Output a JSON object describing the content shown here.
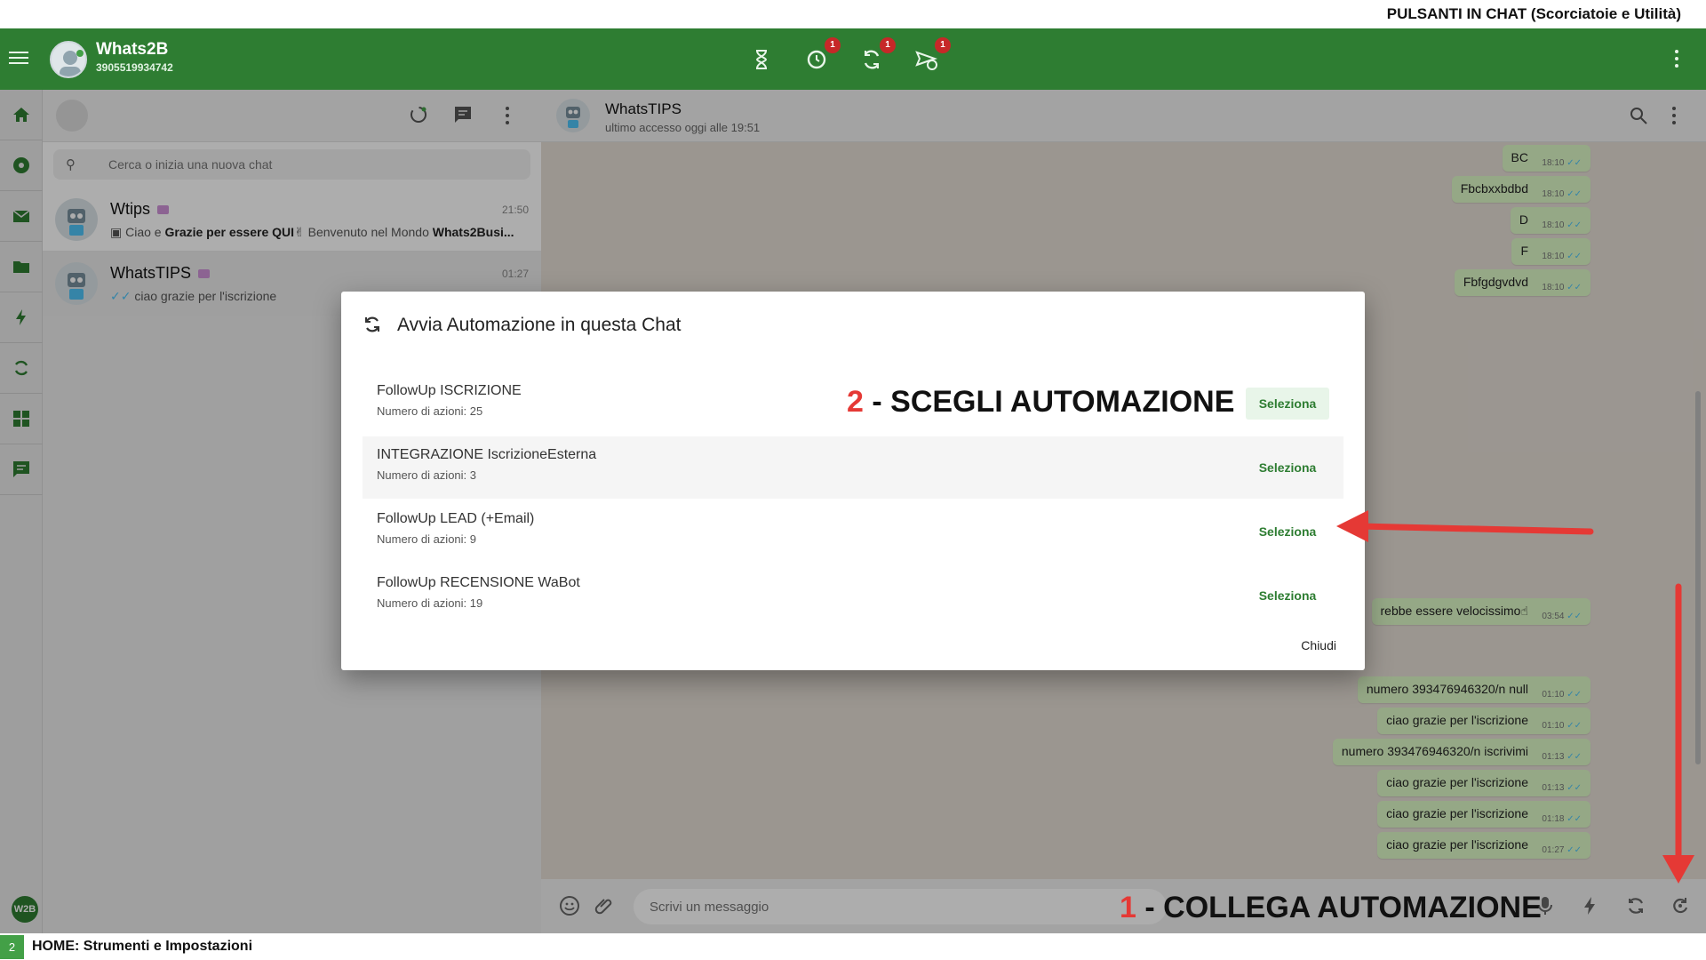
{
  "top_caption": "PULSANTI IN CHAT (Scorciatoie e Utilità)",
  "appbar": {
    "name": "Whats2B",
    "phone": "3905519934742",
    "badges": [
      "1",
      "1",
      "1"
    ]
  },
  "search": {
    "placeholder": "Cerca o inizia una nuova chat"
  },
  "chats": [
    {
      "name": "Wtips",
      "time": "21:50",
      "preview_pre": "Ciao e ",
      "preview_bold": "Grazie per essere QUI",
      "preview_mid": " Benvenuto nel Mondo ",
      "preview_bold2": "Whats2Busi..."
    },
    {
      "name": "WhatsTIPS",
      "time": "01:27",
      "preview": "ciao grazie per l'iscrizione"
    }
  ],
  "conversation": {
    "name": "WhatsTIPS",
    "status": "ultimo accesso oggi alle 19:51",
    "messages": [
      {
        "text": "BC",
        "time": "18:10"
      },
      {
        "text": "Fbcbxxbdbd",
        "time": "18:10"
      },
      {
        "text": "D",
        "time": "18:10"
      },
      {
        "text": "F",
        "time": "18:10"
      },
      {
        "text": "Fbfgdgvdvd",
        "time": "18:10"
      },
      {
        "text": "rebbe essere velocissimo",
        "time": "03:54"
      },
      {
        "text": "numero 393476946320/n null",
        "time": "01:10"
      },
      {
        "text": "ciao grazie per l'iscrizione",
        "time": "01:10"
      },
      {
        "text": "numero 393476946320/n iscrivimi",
        "time": "01:13"
      },
      {
        "text": "ciao grazie per l'iscrizione",
        "time": "01:13"
      },
      {
        "text": "ciao grazie per l'iscrizione",
        "time": "01:18"
      },
      {
        "text": "ciao grazie per l'iscrizione",
        "time": "01:27"
      }
    ],
    "composer_placeholder": "Scrivi un messaggio"
  },
  "modal": {
    "title": "Avvia Automazione in questa Chat",
    "options": [
      {
        "name": "FollowUp ISCRIZIONE",
        "sub": "Numero di azioni: 25",
        "button": "Seleziona"
      },
      {
        "name": "INTEGRAZIONE IscrizioneEsterna",
        "sub": "Numero di azioni: 3",
        "button": "Seleziona"
      },
      {
        "name": "FollowUp LEAD (+Email)",
        "sub": "Numero di azioni: 9",
        "button": "Seleziona"
      },
      {
        "name": "FollowUp RECENSIONE WaBot",
        "sub": "Numero di azioni: 19",
        "button": "Seleziona"
      }
    ],
    "close": "Chiudi"
  },
  "annotations": {
    "a2_num": "2",
    "a2_text": " - SCEGLI AUTOMAZIONE",
    "a1_num": "1",
    "a1_text": " - COLLEGA AUTOMAZIONE"
  },
  "bottom_caption": {
    "page": "2",
    "text": "HOME: Strumenti e Impostazioni"
  },
  "rail_logo": "W2B",
  "colors": {
    "brand": "#2e7d32",
    "badge": "#c62828",
    "bubble": "#dcf8c6",
    "annotation_arrow": "#e53935"
  }
}
